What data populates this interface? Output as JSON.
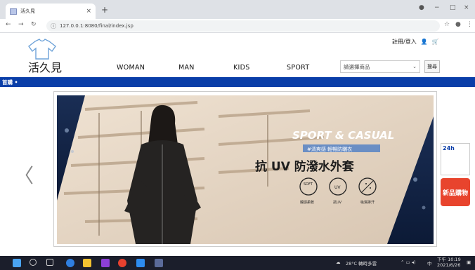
{
  "browser": {
    "tab_title": "活久見",
    "tab_close": "×",
    "new_tab": "+",
    "url": "127.0.0.1:8080/final/index.jsp",
    "window": {
      "minimize": "−",
      "maximize": "□",
      "close": "×"
    }
  },
  "site": {
    "logo_text": "活久見",
    "top_links": {
      "login": "註冊/登入",
      "user_icon": "👤",
      "cart_icon": "🛒"
    },
    "nav": [
      "WOMAN",
      "MAN",
      "KIDS",
      "SPORT"
    ],
    "select_placeholder": "請選擇商品",
    "search_label": "搜尋",
    "bluebar_text": "首購 •"
  },
  "banner": {
    "headline_en": "SPORT & CASUAL",
    "tagline": "#清爽感 輕暢防曬衣",
    "headline_zh": "抗 UV 防潑水外套",
    "features": [
      {
        "icon": "SOFT",
        "label": "觸感柔軟"
      },
      {
        "icon": "UV",
        "label": "抗UV"
      },
      {
        "icon": "splash",
        "label": "吸濕排汗"
      }
    ],
    "prev_arrow": "〈",
    "ad1_text": "24h",
    "ad2_text": "新品購物"
  },
  "taskbar": {
    "weather": "28°C 轉時多雲",
    "ime": "中",
    "time": "下午 10:19",
    "date": "2021/6/26"
  },
  "colors": {
    "brand_blue": "#0a3ea8",
    "ad_red": "#e8442d",
    "banner_bg": "#e6d8c8"
  }
}
